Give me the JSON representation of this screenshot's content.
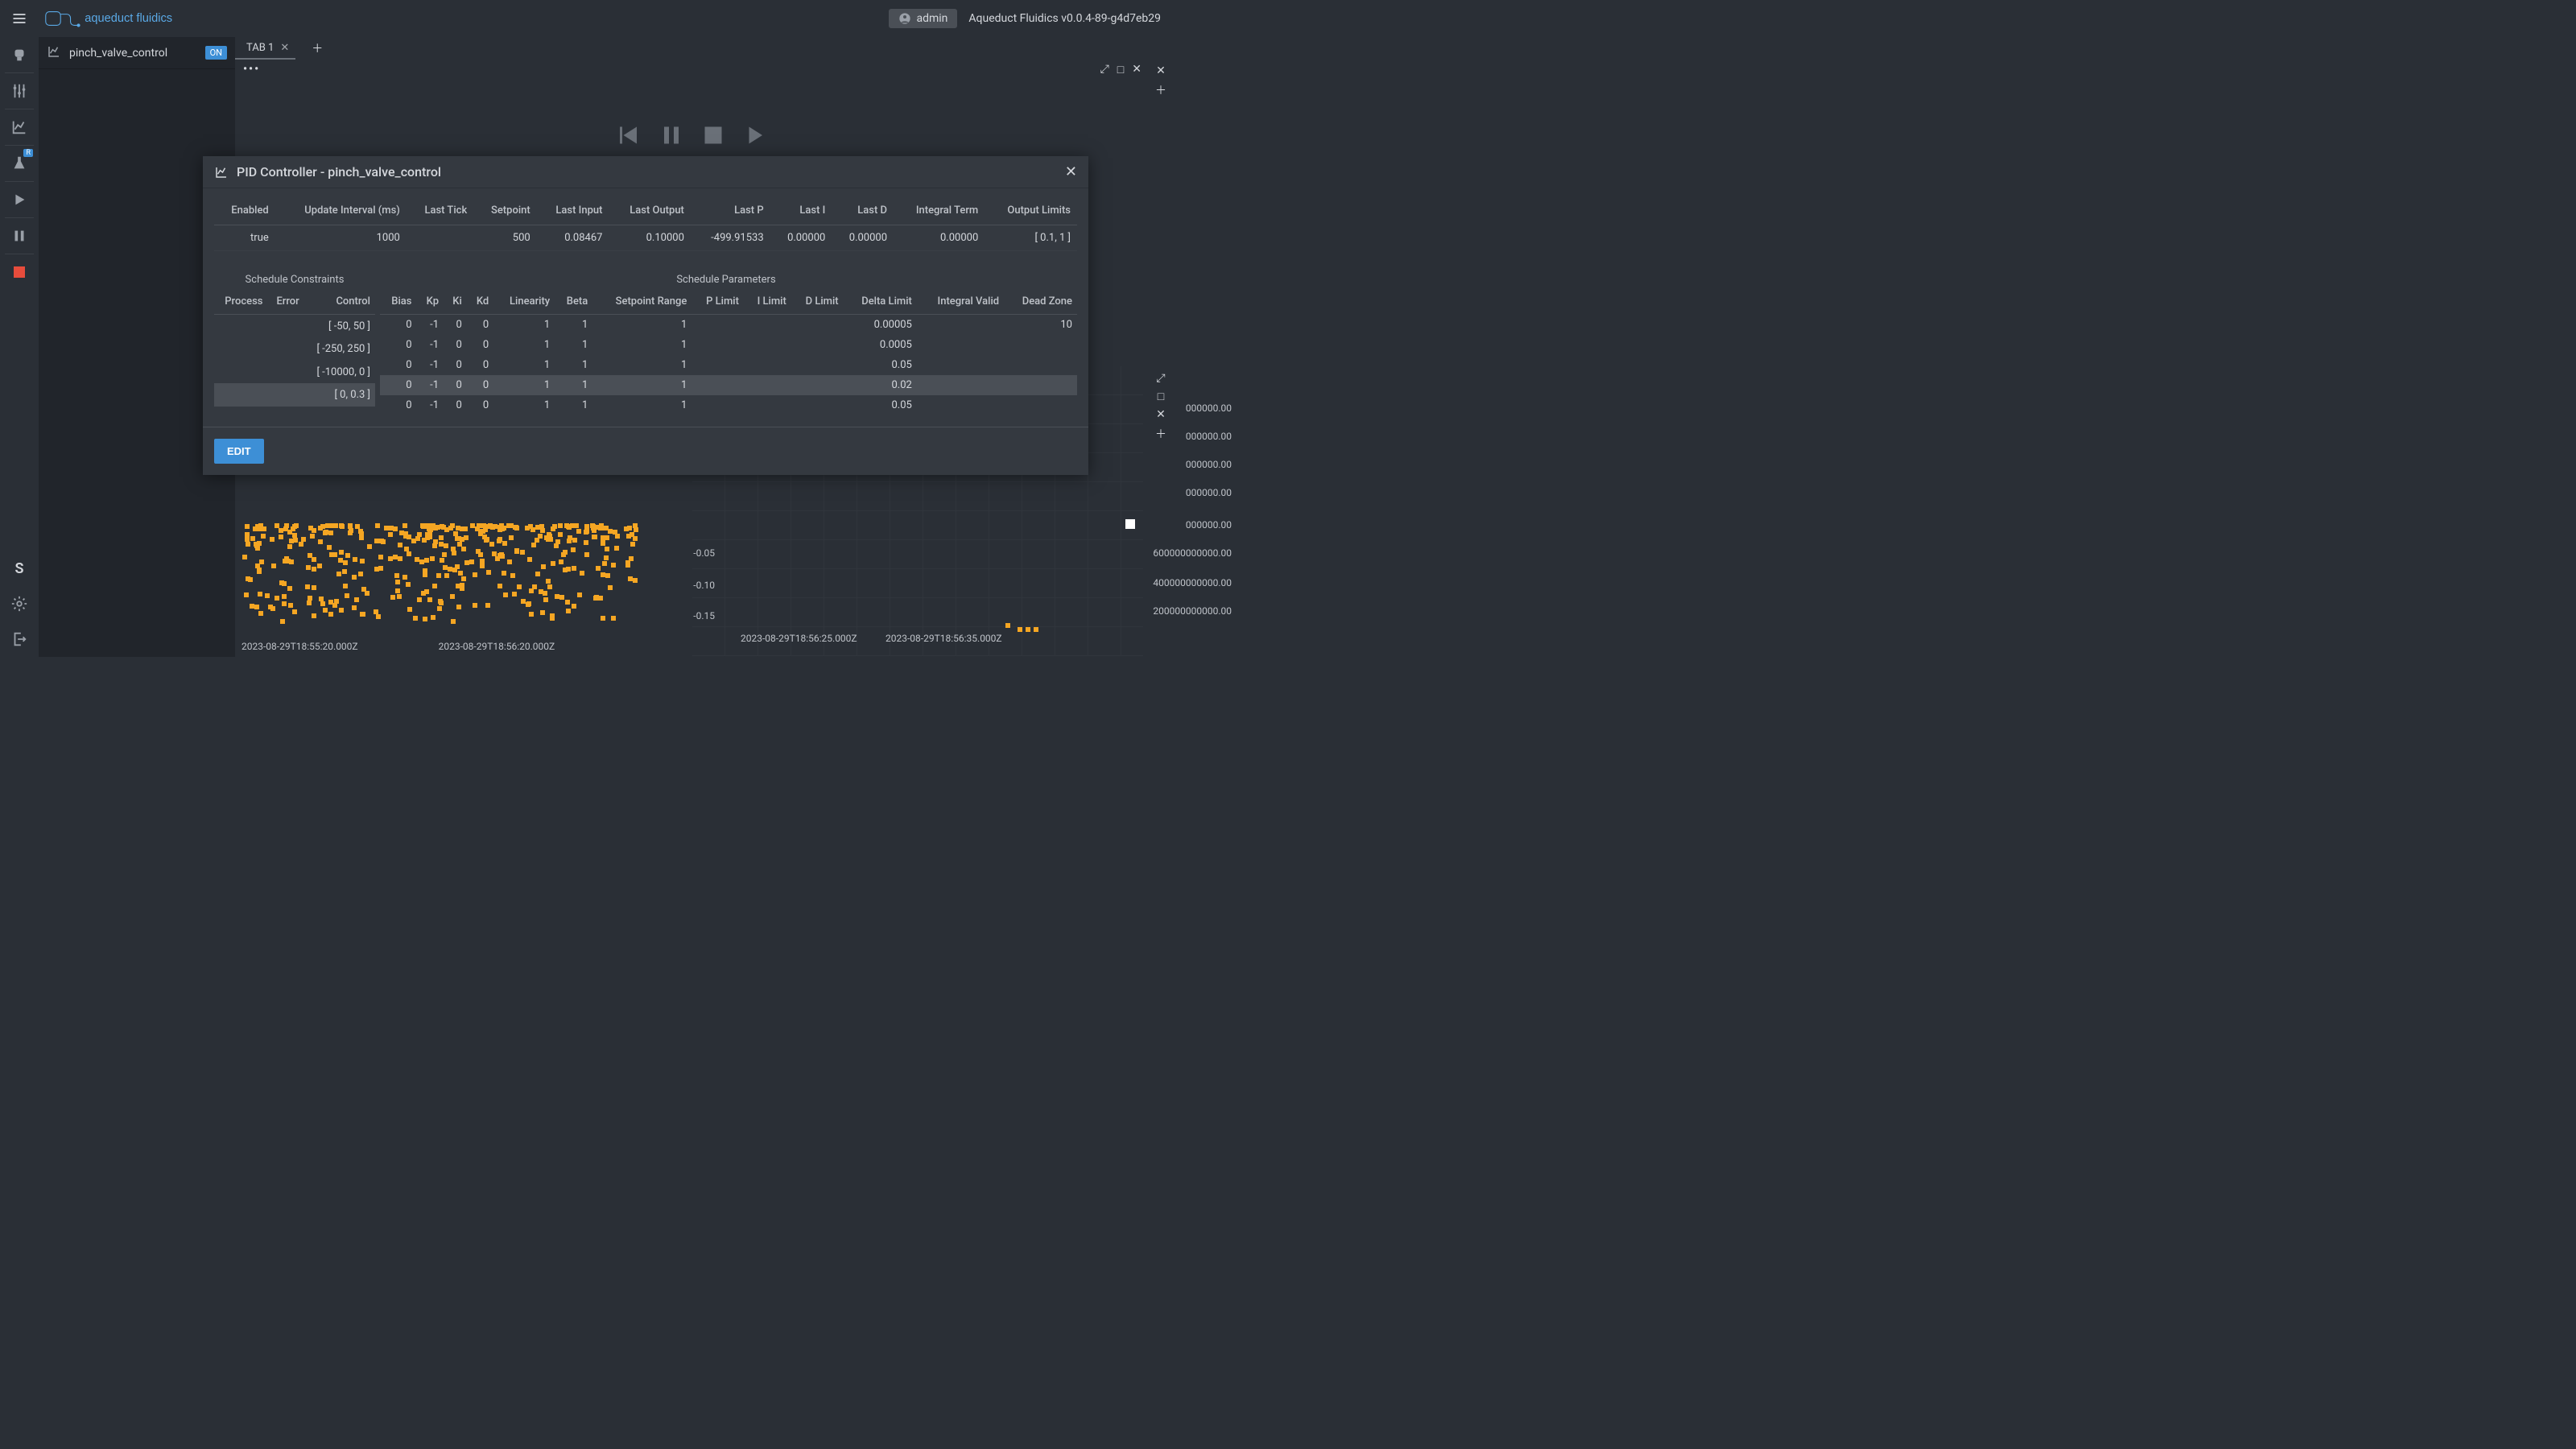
{
  "header": {
    "brand": "aqueduct fluidics",
    "user": "admin",
    "version": "Aqueduct Fluidics v0.0.4-89-g4d7eb29"
  },
  "sidebar": {
    "item_name": "pinch_valve_control",
    "on_badge": "ON"
  },
  "tabs": {
    "items": [
      {
        "label": "TAB 1"
      }
    ]
  },
  "modal": {
    "title": "PID Controller - pinch_valve_control",
    "edit_label": "EDIT",
    "status_headers": [
      "Enabled",
      "Update Interval (ms)",
      "Last Tick",
      "Setpoint",
      "Last Input",
      "Last Output",
      "Last P",
      "Last I",
      "Last D",
      "Integral Term",
      "Output Limits"
    ],
    "status_row": [
      "true",
      "1000",
      "",
      "500",
      "0.08467",
      "0.10000",
      "-499.91533",
      "0.00000",
      "0.00000",
      "0.00000",
      "[ 0.1, 1 ]"
    ],
    "sec_constraints": "Schedule Constraints",
    "sec_params": "Schedule Parameters",
    "constraint_headers": [
      "Process",
      "Error",
      "Control"
    ],
    "param_headers": [
      "Bias",
      "Kp",
      "Ki",
      "Kd",
      "Linearity",
      "Beta",
      "Setpoint Range",
      "P Limit",
      "I Limit",
      "D Limit",
      "Delta Limit",
      "Integral Valid",
      "Dead Zone"
    ],
    "rows": [
      {
        "constraints": [
          "",
          "",
          "[ -50, 50 ]"
        ],
        "params": [
          "0",
          "-1",
          "0",
          "0",
          "1",
          "1",
          "1",
          "",
          "",
          "",
          "0.00005",
          "",
          "10"
        ],
        "hi": false
      },
      {
        "constraints": [
          "",
          "",
          "[ -250, 250 ]"
        ],
        "params": [
          "0",
          "-1",
          "0",
          "0",
          "1",
          "1",
          "1",
          "",
          "",
          "",
          "0.0005",
          "",
          ""
        ],
        "hi": false
      },
      {
        "constraints": [
          "",
          "",
          "[ -10000, 0 ]"
        ],
        "params": [
          "0",
          "-1",
          "0",
          "0",
          "1",
          "1",
          "1",
          "",
          "",
          "",
          "0.05",
          "",
          ""
        ],
        "hi": false
      },
      {
        "constraints": [
          "",
          "",
          "[ 0, 0.3 ]"
        ],
        "params": [
          "0",
          "-1",
          "0",
          "0",
          "1",
          "1",
          "1",
          "",
          "",
          "",
          "0.02",
          "",
          ""
        ],
        "hi": true
      },
      {
        "constraints": [
          "",
          "",
          ""
        ],
        "params": [
          "0",
          "-1",
          "0",
          "0",
          "1",
          "1",
          "1",
          "",
          "",
          "",
          "0.05",
          "",
          ""
        ],
        "hi": false
      }
    ]
  },
  "chart_left": {
    "y_ticks": [
      "-0.05",
      "-0.10",
      "-0.15"
    ],
    "x_ticks": [
      "2023-08-29T18:55:20.000Z",
      "2023-08-29T18:56:20.000Z"
    ]
  },
  "chart_right": {
    "y_ticks": [
      "000000.00",
      "000000.00",
      "000000.00",
      "000000.00",
      "000000.00",
      "600000000000.00",
      "400000000000.00",
      "200000000000.00"
    ],
    "x_ticks": [
      "2023-08-29T18:56:25.000Z",
      "2023-08-29T18:56:35.000Z"
    ]
  }
}
